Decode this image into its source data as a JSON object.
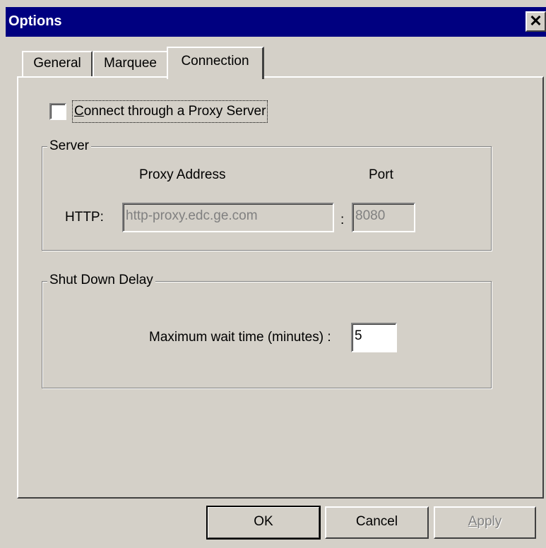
{
  "window": {
    "title": "Options",
    "close_label": "✕"
  },
  "tabs": [
    {
      "label": "General",
      "active": false
    },
    {
      "label": "Marquee",
      "active": false
    },
    {
      "label": "Connection",
      "active": true
    }
  ],
  "proxy_checkbox": {
    "label": "Connect through a  Proxy Server",
    "checked": false
  },
  "server_group": {
    "legend": "Server",
    "address_header": "Proxy Address",
    "port_header": "Port",
    "http_label": "HTTP:",
    "separator": ":",
    "address_value": "http-proxy.edc.ge.com",
    "port_value": "8080"
  },
  "shutdown_group": {
    "legend": "Shut Down Delay",
    "wait_label": "Maximum wait time (minutes) :",
    "wait_value": "5"
  },
  "buttons": {
    "ok": "OK",
    "cancel": "Cancel",
    "apply": "Apply"
  },
  "colors": {
    "titlebar": "#000080",
    "face": "#d4d0c8",
    "disabled_text": "#808080"
  }
}
